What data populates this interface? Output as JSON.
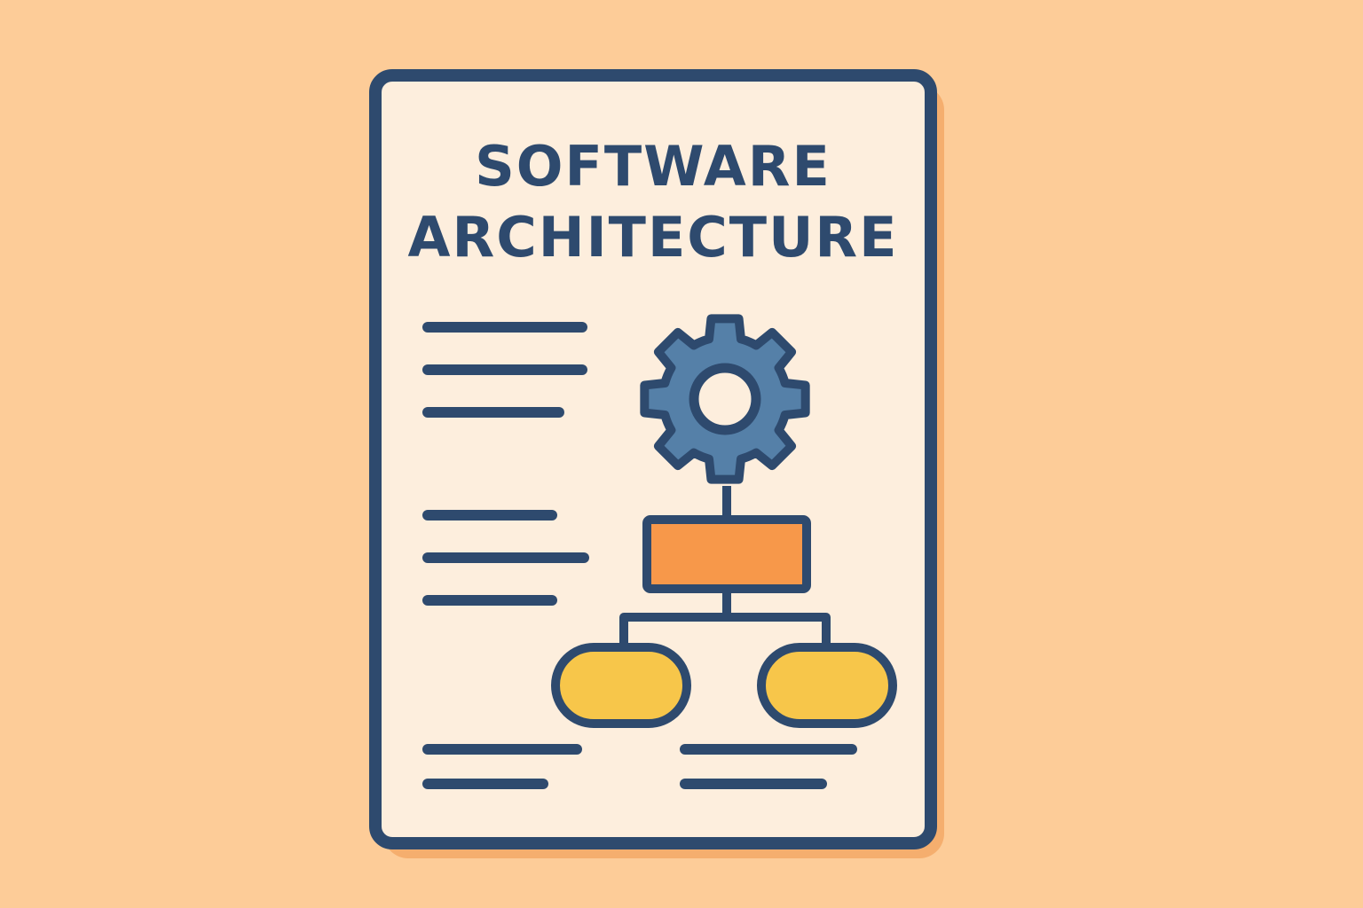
{
  "document": {
    "title_line_1": "SOFTWARE",
    "title_line_2": "ARCHITECTURE"
  },
  "illustration": {
    "icons": [
      "document-icon",
      "gear-icon",
      "hierarchy-diagram-icon"
    ]
  },
  "colors": {
    "background": "#fdcc98",
    "page": "#fdeedd",
    "outline": "#2e4a6e",
    "gear": "#5580a8",
    "box": "#f7984a",
    "nodes": "#f7c64a",
    "shadow": "#f5ae6e"
  }
}
